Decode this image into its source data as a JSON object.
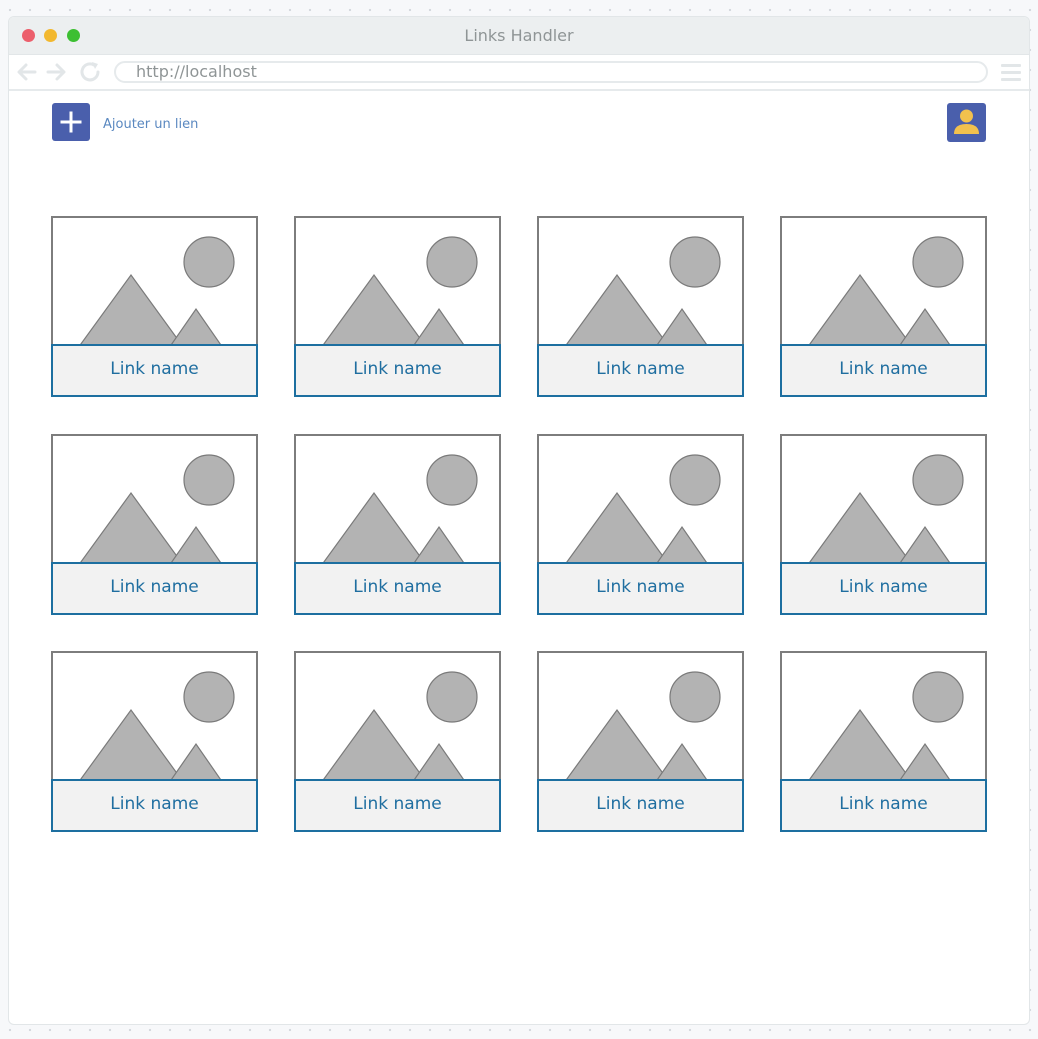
{
  "browser": {
    "title": "Links Handler",
    "url": "http://localhost"
  },
  "header": {
    "add_label": "Ajouter un lien",
    "add_icon": "plus-icon",
    "user_icon": "user-icon"
  },
  "colors": {
    "accent": "#4a5fac",
    "link_text": "#1f6ea0",
    "caption_border": "#1d6fa0",
    "placeholder_gray": "#b3b3b3",
    "user_icon": "#f2c14e"
  },
  "links": [
    {
      "name": "Link name"
    },
    {
      "name": "Link name"
    },
    {
      "name": "Link name"
    },
    {
      "name": "Link name"
    },
    {
      "name": "Link name"
    },
    {
      "name": "Link name"
    },
    {
      "name": "Link name"
    },
    {
      "name": "Link name"
    },
    {
      "name": "Link name"
    },
    {
      "name": "Link name"
    },
    {
      "name": "Link name"
    },
    {
      "name": "Link name"
    }
  ]
}
